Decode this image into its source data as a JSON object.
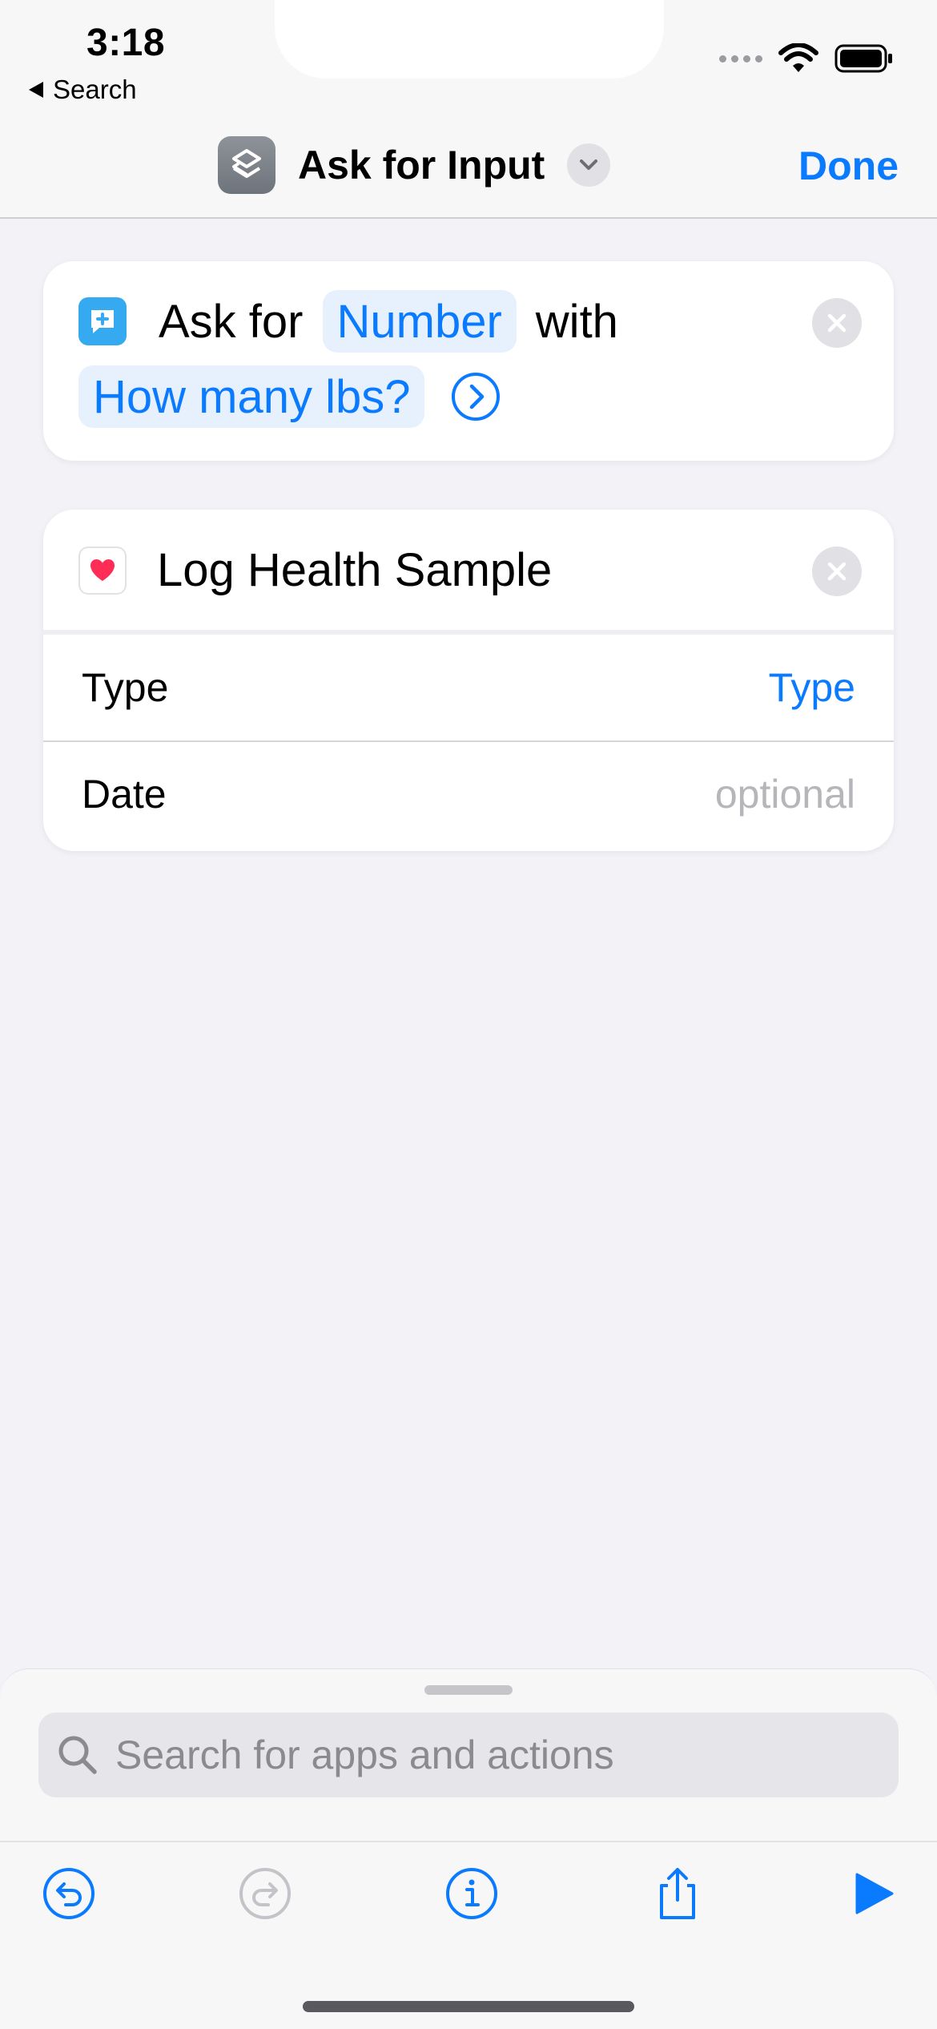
{
  "status_bar": {
    "time": "3:18",
    "back_label": "Search",
    "icons": [
      "cellular-dots-icon",
      "wifi-icon",
      "battery-icon"
    ]
  },
  "nav": {
    "app_icon": "shortcuts-icon",
    "title": "Ask for Input",
    "done_label": "Done"
  },
  "ask_card": {
    "icon": "message-plus-icon",
    "word_ask_for": "Ask for",
    "type_token": "Number",
    "word_with": "with",
    "prompt_token": "How many lbs?"
  },
  "health_card": {
    "icon": "heart-icon",
    "title": "Log Health Sample",
    "rows": [
      {
        "label": "Type",
        "value": "Type"
      },
      {
        "label": "Date",
        "value": "optional"
      }
    ]
  },
  "sheet": {
    "search_placeholder": "Search for apps and actions",
    "toolbar": [
      "undo-icon",
      "redo-icon",
      "info-icon",
      "share-icon",
      "play-icon"
    ]
  },
  "colors": {
    "accent": "#0a7aff",
    "background": "#f2f2f7",
    "card": "#ffffff",
    "placeholder": "#b5b5ba",
    "heart": "#ff2d55",
    "message_icon": "#35aaf0"
  }
}
